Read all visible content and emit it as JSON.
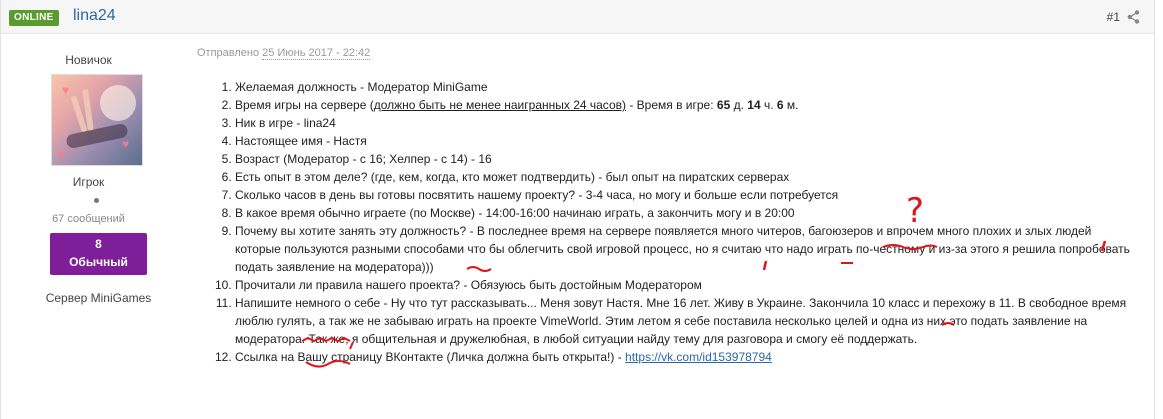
{
  "header": {
    "online_badge": "ONLINE",
    "author_name": "lina24",
    "post_number": "#1"
  },
  "author": {
    "rank_title": "Новичок",
    "group_title": "Игрок",
    "post_count": "67 сообщений",
    "reputation_count": "8",
    "reputation_label": "Обычный",
    "server_label": "Сервер MiniGames"
  },
  "post": {
    "posted_prefix": "Отправлено",
    "posted_date": "25 Июнь 2017 - 22:42",
    "items": [
      "Желаемая должность - Модератор MiniGame",
      {
        "pre": "Время игры на сервере (",
        "underlined": "должно быть не менее наигранных 24 часов)",
        "mid": " - Время в игре: ",
        "days": "65",
        "d_label": " д. ",
        "hours": "14",
        "h_label": " ч. ",
        "minutes": "6",
        "m_label": " м."
      },
      "Ник в игре - lina24",
      "Настоящее имя - Настя",
      "Возраст  (Модератор - с 16; Хелпер - с 14) - 16",
      "Есть опыт в этом деле? (где, кем, когда, кто может подтвердить) - был опыт на пиратских серверах",
      "Сколько часов в день вы готовы посвятить нашему проекту? - 3-4 часа, но могу и больше если потребуется",
      "В какое время обычно играете (по Москве) - 14:00-16:00 начинаю играть, а закончить могу и в 20:00",
      "Почему вы хотите занять эту должность? - В последнее время на сервере появляется много читеров, багоюзеров и впрочем много плохих и злых людей которые пользуются разными способами что бы облегчить свой игровой процесс, но я считаю что надо играть по-честному и из-за этого я решила попробовать подать заявление на модератора)))",
      "Прочитали ли правила нашего проекта? - Обязуюсь быть достойным Модератором",
      "Напишите немного о себе - Ну что тут рассказывать... Меня зовут Настя. Мне 16 лет. Живу в Украине. Закончила 10 класс и перехожу в 11. В свободное время люблю гулять, а так же не забываю играть на проекте VimeWorld. Этим летом я себе поставила несколько целей и одна из них это подать заявление на модератора. Так же, я общительная и дружелюбная, в любой ситуации найду тему для разговора и смогу её поддержать.",
      {
        "pre": "Ссылка на Вашу страницу ВКонтакте (Личка должна быть открыта!) - ",
        "link": "https://vk.com/id153978794"
      }
    ],
    "annotation_question": "?"
  },
  "colors": {
    "online_green": "#5a9b2f",
    "name_blue": "#2a68a6",
    "rep_purple": "#7e1e98",
    "annotation_red": "#e0141b"
  },
  "icons": [
    "share-icon",
    "status-dot-icon"
  ]
}
